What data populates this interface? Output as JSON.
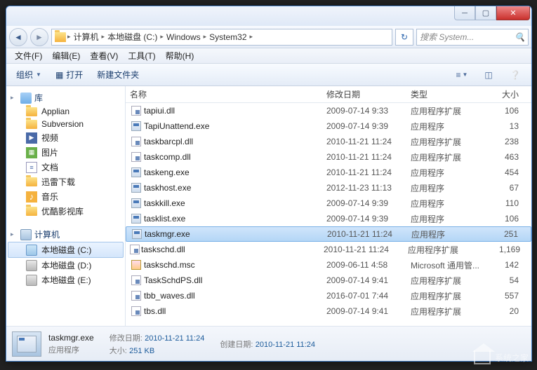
{
  "breadcrumbs": [
    "计算机",
    "本地磁盘 (C:)",
    "Windows",
    "System32"
  ],
  "search_placeholder": "搜索 System...",
  "menus": {
    "file": "文件(F)",
    "edit": "编辑(E)",
    "view": "查看(V)",
    "tools": "工具(T)",
    "help": "帮助(H)"
  },
  "toolbar": {
    "organize": "组织",
    "open": "打开",
    "newfolder": "新建文件夹"
  },
  "nav": {
    "library": "库",
    "libitems": [
      "Applian",
      "Subversion",
      "视频",
      "图片",
      "文档",
      "迅雷下载",
      "音乐",
      "优酷影视库"
    ],
    "computer": "计算机",
    "drives": [
      "本地磁盘 (C:)",
      "本地磁盘 (D:)",
      "本地磁盘 (E:)"
    ]
  },
  "columns": {
    "name": "名称",
    "date": "修改日期",
    "type": "类型",
    "size": "大小"
  },
  "files": [
    {
      "name": "tapiui.dll",
      "date": "2009-07-14 9:33",
      "type": "应用程序扩展",
      "size": "106",
      "icon": "dll"
    },
    {
      "name": "TapiUnattend.exe",
      "date": "2009-07-14 9:39",
      "type": "应用程序",
      "size": "13",
      "icon": "exe"
    },
    {
      "name": "taskbarcpl.dll",
      "date": "2010-11-21 11:24",
      "type": "应用程序扩展",
      "size": "238",
      "icon": "dll"
    },
    {
      "name": "taskcomp.dll",
      "date": "2010-11-21 11:24",
      "type": "应用程序扩展",
      "size": "463",
      "icon": "dll"
    },
    {
      "name": "taskeng.exe",
      "date": "2010-11-21 11:24",
      "type": "应用程序",
      "size": "454",
      "icon": "exe"
    },
    {
      "name": "taskhost.exe",
      "date": "2012-11-23 11:13",
      "type": "应用程序",
      "size": "67",
      "icon": "exe"
    },
    {
      "name": "taskkill.exe",
      "date": "2009-07-14 9:39",
      "type": "应用程序",
      "size": "110",
      "icon": "exe"
    },
    {
      "name": "tasklist.exe",
      "date": "2009-07-14 9:39",
      "type": "应用程序",
      "size": "106",
      "icon": "exe"
    },
    {
      "name": "taskmgr.exe",
      "date": "2010-11-21 11:24",
      "type": "应用程序",
      "size": "251",
      "icon": "exe",
      "selected": true
    },
    {
      "name": "taskschd.dll",
      "date": "2010-11-21 11:24",
      "type": "应用程序扩展",
      "size": "1,169",
      "icon": "dll"
    },
    {
      "name": "taskschd.msc",
      "date": "2009-06-11 4:58",
      "type": "Microsoft 通用管...",
      "size": "142",
      "icon": "msc"
    },
    {
      "name": "TaskSchdPS.dll",
      "date": "2009-07-14 9:41",
      "type": "应用程序扩展",
      "size": "54",
      "icon": "dll"
    },
    {
      "name": "tbb_waves.dll",
      "date": "2016-07-01 7:44",
      "type": "应用程序扩展",
      "size": "557",
      "icon": "dll"
    },
    {
      "name": "tbs.dll",
      "date": "2009-07-14 9:41",
      "type": "应用程序扩展",
      "size": "20",
      "icon": "dll"
    }
  ],
  "details": {
    "name": "taskmgr.exe",
    "type": "应用程序",
    "mod_label": "修改日期:",
    "mod_val": "2010-11-21 11:24",
    "size_label": "大小:",
    "size_val": "251 KB",
    "create_label": "创建日期:",
    "create_val": "2010-11-21 11:24"
  },
  "watermark": "系统之家"
}
